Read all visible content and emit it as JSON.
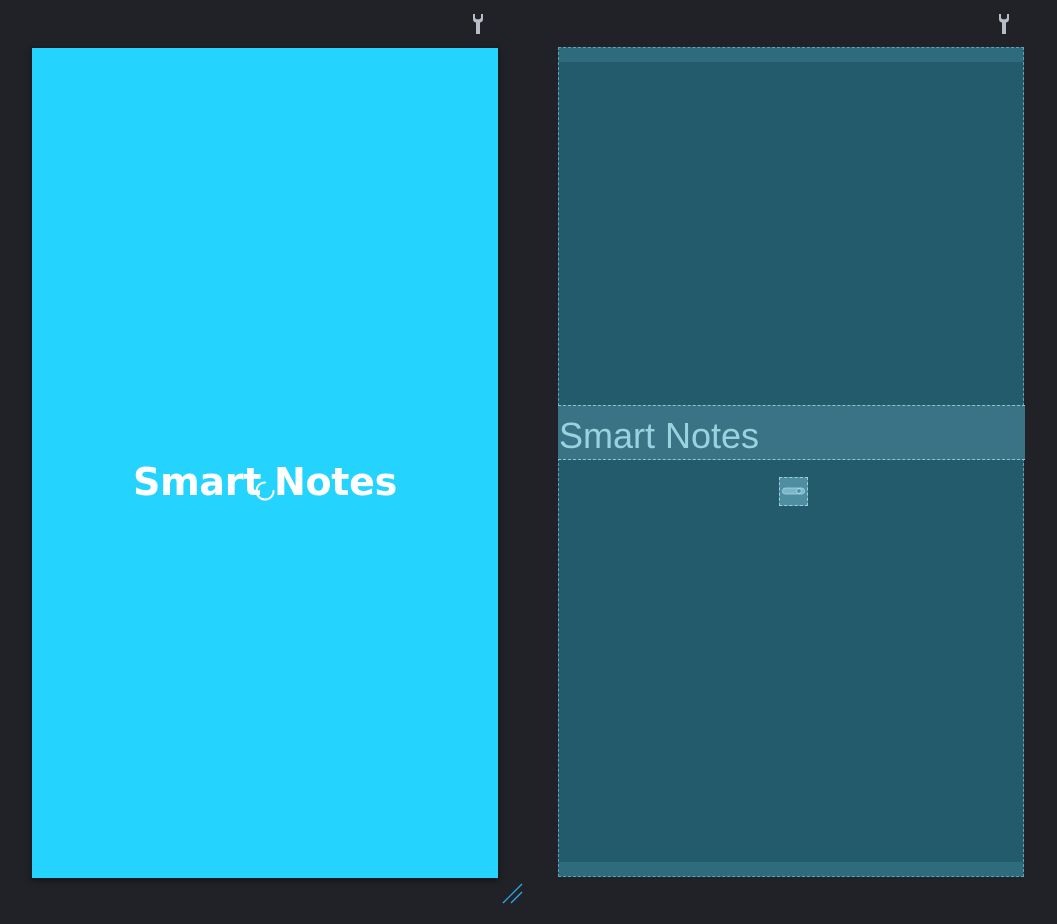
{
  "design_preview": {
    "title": "Smart Notes",
    "background_color": "#25d3ff",
    "title_color": "#ffffff",
    "loading_indicator": "spinner-icon"
  },
  "blueprint_preview": {
    "title": "Smart Notes",
    "background_color": "#235b6d",
    "highlight_color": "#3a7385",
    "outline_color": "#5fa3b6",
    "progress_placeholder": "progress-bar-icon"
  },
  "toolbar": {
    "design_settings_icon": "wrench-icon",
    "blueprint_settings_icon": "wrench-icon"
  },
  "resize_handle_icon": "resize-handle-icon",
  "colors": {
    "workspace_background": "#202228",
    "icon_color": "#b8bcc4",
    "accent": "#2fa8e8"
  }
}
